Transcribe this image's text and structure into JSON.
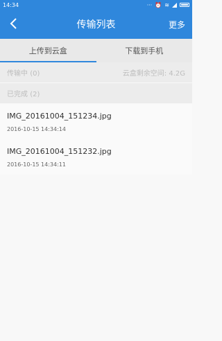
{
  "status_bar": {
    "time": "14:34",
    "icons": [
      "dots-icon",
      "alarm-icon",
      "wifi-icon",
      "signal-icon",
      "battery-icon"
    ]
  },
  "app_bar": {
    "back_icon": "chevron-left-icon",
    "title": "传输列表",
    "more_label": "更多"
  },
  "tabs": [
    {
      "label": "上传到云盒",
      "active": true
    },
    {
      "label": "下载到手机",
      "active": false
    }
  ],
  "sections": {
    "in_progress": {
      "label": "传输中",
      "count": "(0)",
      "space_text": "云盒剩余空间: 4.2G"
    },
    "completed": {
      "label": "已完成",
      "count": "(2)"
    }
  },
  "files": [
    {
      "name": "IMG_20161004_151234.jpg",
      "time": "2016-10-15 14:34:14"
    },
    {
      "name": "IMG_20161004_151232.jpg",
      "time": "2016-10-15 14:34:11"
    }
  ],
  "colors": {
    "accent": "#2f87dc",
    "tab_bg": "#e9e9e9",
    "section_text": "#bdbdbd"
  }
}
